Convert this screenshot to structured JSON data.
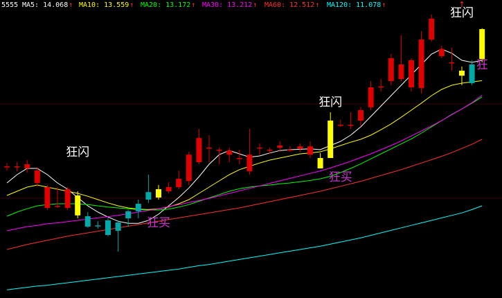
{
  "chart_data": {
    "type": "candlestick",
    "symbol": "5555",
    "colors": {
      "background": "#000000",
      "separator": "#3a0000",
      "up": "#e00000",
      "down": "#00a8a8",
      "signal": "#ffff00"
    },
    "ylim": [
      8.4,
      15.3
    ],
    "legend": [
      {
        "name": "MA5",
        "label": "MA5:",
        "value": "14.068",
        "color": "#ffffff"
      },
      {
        "name": "MA10",
        "label": "MA10:",
        "value": "13.559",
        "color": "#ffff00"
      },
      {
        "name": "MA20",
        "label": "MA20:",
        "value": "13.172",
        "color": "#00ff00"
      },
      {
        "name": "MA30",
        "label": "MA30:",
        "value": "13.212",
        "color": "#ff00ff"
      },
      {
        "name": "MA60",
        "label": "MA60:",
        "value": "12.512",
        "color": "#ff3030"
      },
      {
        "name": "MA120",
        "label": "MA120:",
        "value": "11.078",
        "color": "#00ffff"
      }
    ],
    "candles": [
      {
        "o": 11.5,
        "c": 11.5,
        "h": 11.58,
        "l": 11.4,
        "t": "up"
      },
      {
        "o": 11.5,
        "c": 11.5,
        "h": 11.6,
        "l": 11.38,
        "t": "up"
      },
      {
        "o": 11.45,
        "c": 11.55,
        "h": 11.65,
        "l": 11.35,
        "t": "up"
      },
      {
        "o": 11.4,
        "c": 11.1,
        "h": 11.48,
        "l": 11.02,
        "t": "up"
      },
      {
        "o": 11.0,
        "c": 10.5,
        "h": 11.05,
        "l": 10.45,
        "t": "up"
      },
      {
        "o": 10.55,
        "c": 10.55,
        "h": 11.0,
        "l": 10.5,
        "t": "up"
      },
      {
        "o": 10.95,
        "c": 10.5,
        "h": 11.0,
        "l": 10.45,
        "t": "up"
      },
      {
        "o": 10.8,
        "c": 10.32,
        "h": 10.9,
        "l": 10.25,
        "t": "sig"
      },
      {
        "o": 10.3,
        "c": 10.05,
        "h": 10.4,
        "l": 10.02,
        "t": "down"
      },
      {
        "o": 10.08,
        "c": 10.08,
        "h": 10.18,
        "l": 10.0,
        "t": "down"
      },
      {
        "o": 10.2,
        "c": 9.85,
        "h": 10.25,
        "l": 9.82,
        "t": "down"
      },
      {
        "o": 10.15,
        "c": 9.95,
        "h": 10.2,
        "l": 9.45,
        "t": "down"
      },
      {
        "o": 10.42,
        "c": 10.25,
        "h": 10.45,
        "l": 10.05,
        "t": "down"
      },
      {
        "o": 10.42,
        "c": 10.6,
        "h": 10.7,
        "l": 10.25,
        "t": "down"
      },
      {
        "o": 10.88,
        "c": 10.7,
        "h": 11.3,
        "l": 10.62,
        "t": "down"
      },
      {
        "o": 10.75,
        "c": 10.95,
        "h": 11.05,
        "l": 10.7,
        "t": "sig"
      },
      {
        "o": 10.9,
        "c": 11.0,
        "h": 11.12,
        "l": 10.85,
        "t": "up"
      },
      {
        "o": 11.0,
        "c": 11.2,
        "h": 11.4,
        "l": 10.95,
        "t": "up"
      },
      {
        "o": 11.15,
        "c": 11.78,
        "h": 11.85,
        "l": 11.05,
        "t": "up"
      },
      {
        "o": 11.6,
        "c": 12.18,
        "h": 12.4,
        "l": 11.55,
        "t": "up"
      },
      {
        "o": 11.95,
        "c": 11.95,
        "h": 12.25,
        "l": 11.6,
        "t": "up"
      },
      {
        "o": 11.9,
        "c": 11.9,
        "h": 11.95,
        "l": 11.55,
        "t": "up"
      },
      {
        "o": 11.78,
        "c": 11.88,
        "h": 11.95,
        "l": 11.6,
        "t": "up"
      },
      {
        "o": 11.7,
        "c": 11.7,
        "h": 11.9,
        "l": 11.55,
        "t": "up"
      },
      {
        "o": 11.38,
        "c": 11.78,
        "h": 12.4,
        "l": 11.3,
        "t": "up"
      },
      {
        "o": 11.95,
        "c": 11.95,
        "h": 12.05,
        "l": 11.78,
        "t": "up"
      },
      {
        "o": 11.9,
        "c": 11.9,
        "h": 11.95,
        "l": 11.8,
        "t": "up"
      },
      {
        "o": 11.95,
        "c": 12.0,
        "h": 12.1,
        "l": 11.85,
        "t": "up"
      },
      {
        "o": 11.9,
        "c": 11.9,
        "h": 11.98,
        "l": 11.85,
        "t": "up"
      },
      {
        "o": 11.92,
        "c": 11.98,
        "h": 12.05,
        "l": 11.85,
        "t": "up"
      },
      {
        "o": 11.78,
        "c": 11.98,
        "h": 12.1,
        "l": 11.7,
        "t": "up"
      },
      {
        "o": 11.45,
        "c": 11.7,
        "h": 11.82,
        "l": 11.45,
        "t": "sig"
      },
      {
        "o": 11.7,
        "c": 12.6,
        "h": 12.8,
        "l": 11.7,
        "t": "sig"
      },
      {
        "o": 12.5,
        "c": 12.5,
        "h": 12.62,
        "l": 12.45,
        "t": "up"
      },
      {
        "o": 12.5,
        "c": 12.5,
        "h": 12.8,
        "l": 12.4,
        "t": "up"
      },
      {
        "o": 12.6,
        "c": 12.85,
        "h": 12.92,
        "l": 12.48,
        "t": "up"
      },
      {
        "o": 12.92,
        "c": 13.4,
        "h": 13.55,
        "l": 12.85,
        "t": "up"
      },
      {
        "o": 13.42,
        "c": 13.42,
        "h": 13.6,
        "l": 13.3,
        "t": "up"
      },
      {
        "o": 13.55,
        "c": 14.1,
        "h": 14.2,
        "l": 13.45,
        "t": "up"
      },
      {
        "o": 13.6,
        "c": 13.95,
        "h": 14.65,
        "l": 13.55,
        "t": "up"
      },
      {
        "o": 13.4,
        "c": 14.05,
        "h": 14.1,
        "l": 13.3,
        "t": "up"
      },
      {
        "o": 13.38,
        "c": 14.55,
        "h": 14.75,
        "l": 13.25,
        "t": "up"
      },
      {
        "o": 14.55,
        "c": 15.05,
        "h": 15.15,
        "l": 14.5,
        "t": "up"
      },
      {
        "o": 14.15,
        "c": 14.32,
        "h": 14.4,
        "l": 14.1,
        "t": "up"
      },
      {
        "o": 14.0,
        "c": 14.0,
        "h": 14.35,
        "l": 13.8,
        "t": "up"
      },
      {
        "o": 13.8,
        "c": 13.68,
        "h": 13.9,
        "l": 13.45,
        "t": "sig"
      },
      {
        "o": 13.95,
        "c": 13.5,
        "h": 14.05,
        "l": 13.45,
        "t": "down"
      },
      {
        "o": 14.08,
        "c": 14.8,
        "h": 14.82,
        "l": 14.0,
        "t": "sig"
      }
    ],
    "series": [
      {
        "name": "MA5",
        "color": "#ffffff",
        "values": [
          11.1,
          11.3,
          11.45,
          11.45,
          11.3,
          11.1,
          10.95,
          10.75,
          10.55,
          10.4,
          10.28,
          10.18,
          10.13,
          10.13,
          10.2,
          10.35,
          10.55,
          10.75,
          10.98,
          11.25,
          11.55,
          11.78,
          11.88,
          11.8,
          11.72,
          11.75,
          11.82,
          11.88,
          11.9,
          11.91,
          11.92,
          11.9,
          12.0,
          12.1,
          12.25,
          12.45,
          12.7,
          12.95,
          13.2,
          13.45,
          13.7,
          13.95,
          14.2,
          14.32,
          14.22,
          14.05,
          14.0,
          14.05
        ]
      },
      {
        "name": "MA10",
        "color": "#ffff00",
        "values": [
          10.8,
          10.9,
          11.0,
          11.05,
          11.0,
          10.95,
          10.9,
          10.85,
          10.78,
          10.7,
          10.62,
          10.55,
          10.5,
          10.47,
          10.46,
          10.48,
          10.52,
          10.6,
          10.7,
          10.85,
          11.0,
          11.15,
          11.3,
          11.42,
          11.5,
          11.58,
          11.65,
          11.7,
          11.75,
          11.8,
          11.82,
          11.85,
          11.92,
          12.0,
          12.08,
          12.15,
          12.25,
          12.38,
          12.52,
          12.68,
          12.85,
          13.02,
          13.2,
          13.35,
          13.45,
          13.5,
          13.53,
          13.56
        ]
      },
      {
        "name": "MA20",
        "color": "#00ff00",
        "values": [
          10.3,
          10.4,
          10.48,
          10.55,
          10.58,
          10.6,
          10.6,
          10.6,
          10.58,
          10.55,
          10.52,
          10.5,
          10.48,
          10.46,
          10.45,
          10.45,
          10.47,
          10.52,
          10.58,
          10.66,
          10.74,
          10.82,
          10.9,
          10.96,
          11.0,
          11.03,
          11.05,
          11.08,
          11.1,
          11.13,
          11.16,
          11.2,
          11.26,
          11.35,
          11.45,
          11.56,
          11.68,
          11.8,
          11.92,
          12.04,
          12.16,
          12.3,
          12.45,
          12.6,
          12.75,
          12.88,
          13.02,
          13.17
        ]
      },
      {
        "name": "MA30",
        "color": "#ff00ff",
        "values": [
          9.95,
          10.0,
          10.05,
          10.08,
          10.12,
          10.14,
          10.17,
          10.2,
          10.23,
          10.26,
          10.29,
          10.32,
          10.36,
          10.4,
          10.44,
          10.48,
          10.53,
          10.58,
          10.63,
          10.68,
          10.73,
          10.79,
          10.85,
          10.91,
          10.97,
          11.03,
          11.09,
          11.15,
          11.21,
          11.27,
          11.33,
          11.39,
          11.46,
          11.54,
          11.62,
          11.71,
          11.8,
          11.9,
          12.0,
          12.11,
          12.23,
          12.35,
          12.47,
          12.6,
          12.74,
          12.88,
          13.03,
          13.21
        ]
      },
      {
        "name": "MA60",
        "color": "#ff3030",
        "values": [
          9.5,
          9.56,
          9.62,
          9.67,
          9.72,
          9.77,
          9.82,
          9.86,
          9.9,
          9.94,
          9.98,
          10.02,
          10.06,
          10.1,
          10.14,
          10.18,
          10.22,
          10.26,
          10.3,
          10.34,
          10.38,
          10.42,
          10.46,
          10.5,
          10.55,
          10.6,
          10.65,
          10.7,
          10.75,
          10.8,
          10.85,
          10.9,
          10.96,
          11.02,
          11.08,
          11.14,
          11.21,
          11.28,
          11.35,
          11.42,
          11.5,
          11.58,
          11.66,
          11.74,
          11.83,
          11.93,
          12.03,
          12.15
        ]
      },
      {
        "name": "MA120",
        "color": "#00ffff",
        "values": [
          8.53,
          8.56,
          8.59,
          8.62,
          8.64,
          8.67,
          8.7,
          8.73,
          8.76,
          8.79,
          8.82,
          8.85,
          8.88,
          8.91,
          8.94,
          8.97,
          9.0,
          9.03,
          9.07,
          9.11,
          9.14,
          9.18,
          9.22,
          9.26,
          9.3,
          9.34,
          9.38,
          9.42,
          9.46,
          9.5,
          9.54,
          9.58,
          9.63,
          9.68,
          9.73,
          9.78,
          9.84,
          9.9,
          9.96,
          10.02,
          10.08,
          10.14,
          10.2,
          10.26,
          10.32,
          10.38,
          10.46,
          10.55
        ]
      }
    ],
    "annotations": [
      {
        "text": "狂闪",
        "candle": 7,
        "price": 11.75,
        "color": "#ffffff"
      },
      {
        "text": "狂买",
        "candle": 15,
        "price": 10.05,
        "color": "#cc33cc"
      },
      {
        "text": "狂闪",
        "candle": 32,
        "price": 12.95,
        "color": "#ffffff"
      },
      {
        "text": "狂买",
        "candle": 33,
        "price": 11.15,
        "color": "#cc33cc"
      },
      {
        "text": "狂闪",
        "candle": 45,
        "price": 15.1,
        "color": "#ffffff"
      },
      {
        "text": "狂",
        "candle": 47,
        "price": 13.85,
        "color": "#cc33cc"
      }
    ],
    "top_arrows": [
      {
        "candle": 45,
        "glyph": "↑",
        "color": "#ff3030"
      }
    ]
  }
}
